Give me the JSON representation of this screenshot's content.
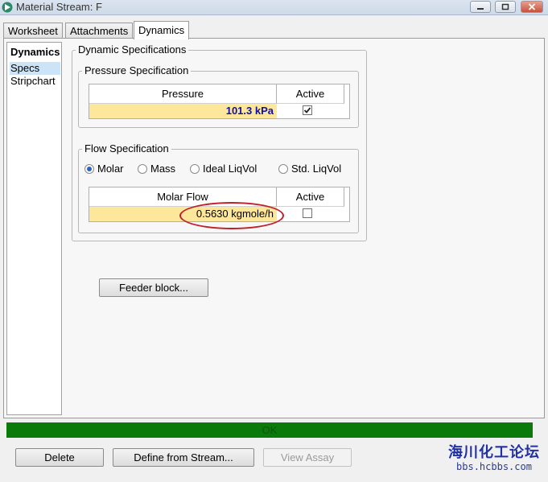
{
  "window": {
    "title": "Material Stream: F",
    "minimize_glyph": "▭",
    "restore_glyph": "□",
    "close_glyph": "✕"
  },
  "tabs": [
    {
      "label": "Worksheet",
      "active": false
    },
    {
      "label": "Attachments",
      "active": false
    },
    {
      "label": "Dynamics",
      "active": true
    }
  ],
  "sidebar": {
    "heading": "Dynamics",
    "items": [
      {
        "label": "Specs",
        "selected": true
      },
      {
        "label": "Stripchart",
        "selected": false
      }
    ]
  },
  "dynamic_specs": {
    "group_label": "Dynamic Specifications",
    "pressure": {
      "group_label": "Pressure Specification",
      "col_value": "Pressure",
      "col_active": "Active",
      "value": "101.3 kPa",
      "active": true
    },
    "flow": {
      "group_label": "Flow Specification",
      "options": [
        "Molar",
        "Mass",
        "Ideal LiqVol",
        "Std. LiqVol"
      ],
      "selected": "Molar",
      "col_value": "Molar Flow",
      "col_active": "Active",
      "value": "0.5630 kgmole/h",
      "active": false
    }
  },
  "feeder_button": "Feeder block...",
  "status": "OK",
  "footer": {
    "delete_label": "Delete",
    "define_label": "Define from Stream...",
    "view_assay_label": "View Assay"
  },
  "watermark": {
    "text": "海川化工论坛",
    "url": "bbs.hcbbs.com"
  },
  "colors": {
    "status_green": "#0a7a0a",
    "input_yellow": "#fce79a",
    "annotation_red": "#c0202a",
    "watermark_blue": "#2030a8"
  }
}
